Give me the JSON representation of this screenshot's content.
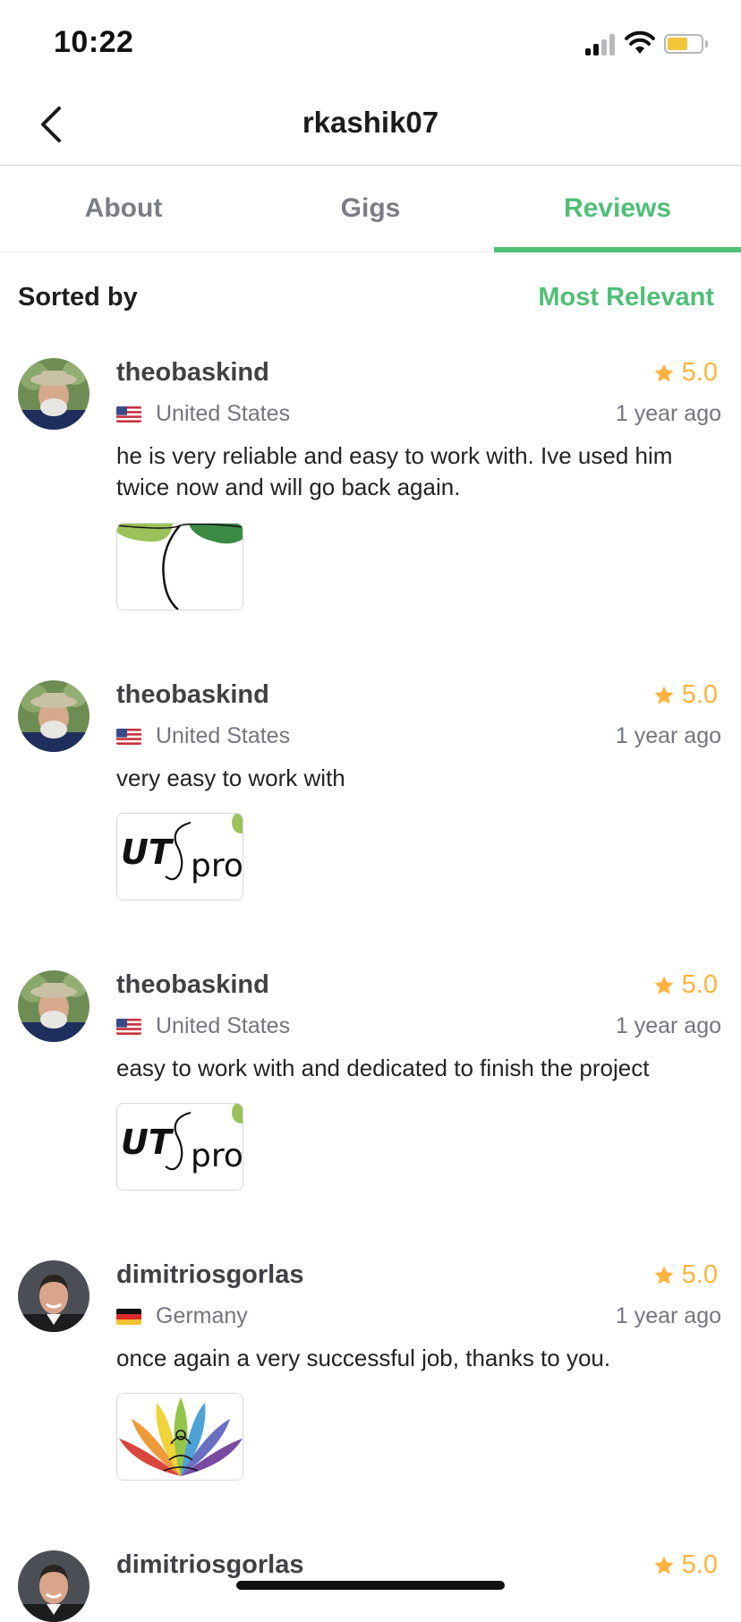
{
  "status_bar": {
    "time": "10:22",
    "signal_bars": 2,
    "battery_level": 0.5
  },
  "header": {
    "title": "rkashik07",
    "back_icon": "chevron-left-icon"
  },
  "tabs": [
    {
      "label": "About",
      "active": false
    },
    {
      "label": "Gigs",
      "active": false
    },
    {
      "label": "Reviews",
      "active": true
    }
  ],
  "sort": {
    "label": "Sorted by",
    "value": "Most Relevant"
  },
  "reviews": [
    {
      "username": "theobaskind",
      "rating": "5.0",
      "country": "United States",
      "date": "1 year ago",
      "text": "he is very reliable and easy to work with. Ive used him twice now and will go back again.",
      "thumbnail": "seedling-logo"
    },
    {
      "username": "theobaskind",
      "rating": "5.0",
      "country": "United States",
      "date": "1 year ago",
      "text": "very easy to work with",
      "thumbnail": "ut-sprout-logo"
    },
    {
      "username": "theobaskind",
      "rating": "5.0",
      "country": "United States",
      "date": "1 year ago",
      "text": "easy to work with and dedicated to finish the project",
      "thumbnail": "ut-sprout-logo"
    },
    {
      "username": "dimitriosgorlas",
      "rating": "5.0",
      "country": "Germany",
      "date": "1 year ago",
      "text": "once again a very successful job, thanks to you.",
      "thumbnail": "lotus-logo"
    },
    {
      "username": "dimitriosgorlas",
      "rating": "5.0"
    }
  ],
  "colors": {
    "accent": "#4fbf76",
    "star": "#ffb33e",
    "muted": "#74767e"
  }
}
